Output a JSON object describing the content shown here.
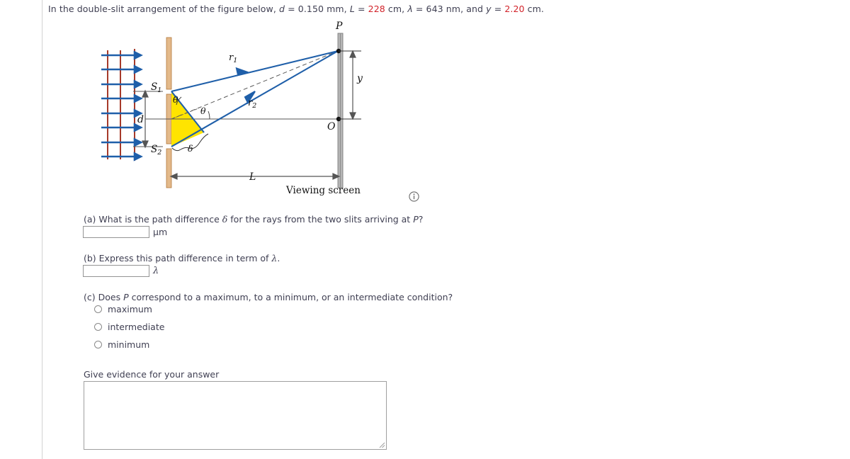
{
  "problem": {
    "statement_parts": {
      "lead": "In the double-slit arrangement of the figure below,",
      "d_sym": "d",
      "d_eq": "= 0.150 mm,",
      "L_sym": "L",
      "L_eq_pre": "=",
      "L_value": "228",
      "L_unit": "cm,",
      "lambda_sym": "λ",
      "lambda_eq": "= 643 nm, and",
      "y_sym": "y",
      "y_eq_pre": "=",
      "y_value": "2.20",
      "y_unit": "cm."
    },
    "highlight_color": "#d2232a"
  },
  "figure": {
    "labels": {
      "P": "P",
      "O": "O",
      "S1": "S",
      "S1_sub": "1",
      "S2": "S",
      "S2_sub": "2",
      "r1": "r",
      "r1_sub": "1",
      "r2": "r",
      "r2_sub": "2",
      "theta1": "θ",
      "theta2": "θ",
      "delta": "δ",
      "d": "d",
      "y": "y",
      "L": "L",
      "viewing_screen": "Viewing screen"
    },
    "colors": {
      "ray": "#1f5fa9",
      "wavefront": "#a63a2a",
      "barrier": "#e3b98a",
      "screen": "#9a9a9a",
      "wedge": "#ffe400",
      "dimension": "#555555"
    },
    "wavefront_line_count": 3,
    "wavefront_arrow_count": 8
  },
  "parts": {
    "a": {
      "label": "(a) What is the path difference",
      "symbol": "δ",
      "label_tail_pre": " for the rays from the two slits arriving at ",
      "P": "P",
      "label_tail_post": "?",
      "input_value": "",
      "unit": "μm"
    },
    "b": {
      "label_pre": "(b) Express this path difference in term of ",
      "symbol": "λ",
      "label_post": ".",
      "input_value": "",
      "unit": "λ"
    },
    "c": {
      "label_pre": "(c) Does ",
      "P": "P",
      "label_post": " correspond to a maximum, to a minimum, or an intermediate condition?",
      "options": [
        {
          "label": "maximum",
          "selected": false
        },
        {
          "label": "intermediate",
          "selected": false
        },
        {
          "label": "minimum",
          "selected": false
        }
      ]
    },
    "evidence": {
      "label": "Give evidence for your answer",
      "value": ""
    }
  },
  "icons": {
    "info": "info-circle-icon",
    "resize": "resize-grip-icon"
  }
}
